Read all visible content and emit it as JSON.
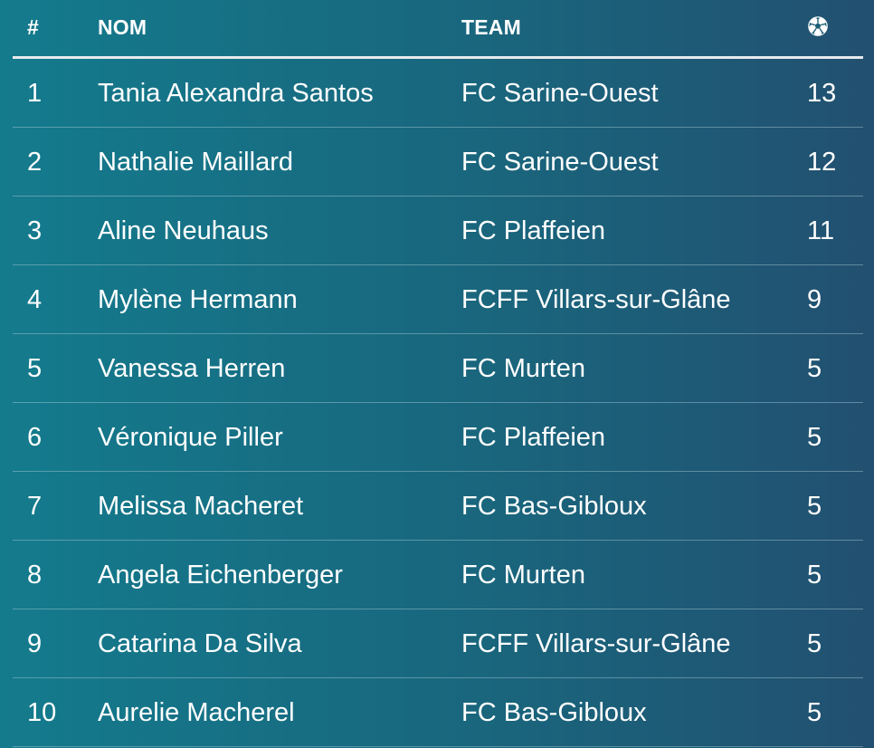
{
  "header": {
    "rank": "#",
    "name": "NOM",
    "team": "TEAM",
    "goals_icon": "soccer-ball-icon"
  },
  "rows": [
    {
      "rank": "1",
      "name": "Tania Alexandra Santos",
      "team": "FC Sarine-Ouest",
      "goals": "13"
    },
    {
      "rank": "2",
      "name": "Nathalie Maillard",
      "team": "FC Sarine-Ouest",
      "goals": "12"
    },
    {
      "rank": "3",
      "name": "Aline Neuhaus",
      "team": "FC Plaffeien",
      "goals": "11"
    },
    {
      "rank": "4",
      "name": "Mylène Hermann",
      "team": "FCFF Villars-sur-Glâne",
      "goals": "9"
    },
    {
      "rank": "5",
      "name": "Vanessa Herren",
      "team": "FC Murten",
      "goals": "5"
    },
    {
      "rank": "6",
      "name": "Véronique Piller",
      "team": "FC Plaffeien",
      "goals": "5"
    },
    {
      "rank": "7",
      "name": "Melissa Macheret",
      "team": "FC Bas-Gibloux",
      "goals": "5"
    },
    {
      "rank": "8",
      "name": "Angela Eichenberger",
      "team": "FC Murten",
      "goals": "5"
    },
    {
      "rank": "9",
      "name": "Catarina Da Silva",
      "team": "FCFF Villars-sur-Glâne",
      "goals": "5"
    },
    {
      "rank": "10",
      "name": "Aurelie Macherel",
      "team": "FC Bas-Gibloux",
      "goals": "5"
    }
  ],
  "colors": {
    "gradient_left": "#147b8d",
    "gradient_mid": "#19667d",
    "gradient_right": "#225070",
    "text": "#ffffff",
    "header_rule": "#e6eaee"
  }
}
